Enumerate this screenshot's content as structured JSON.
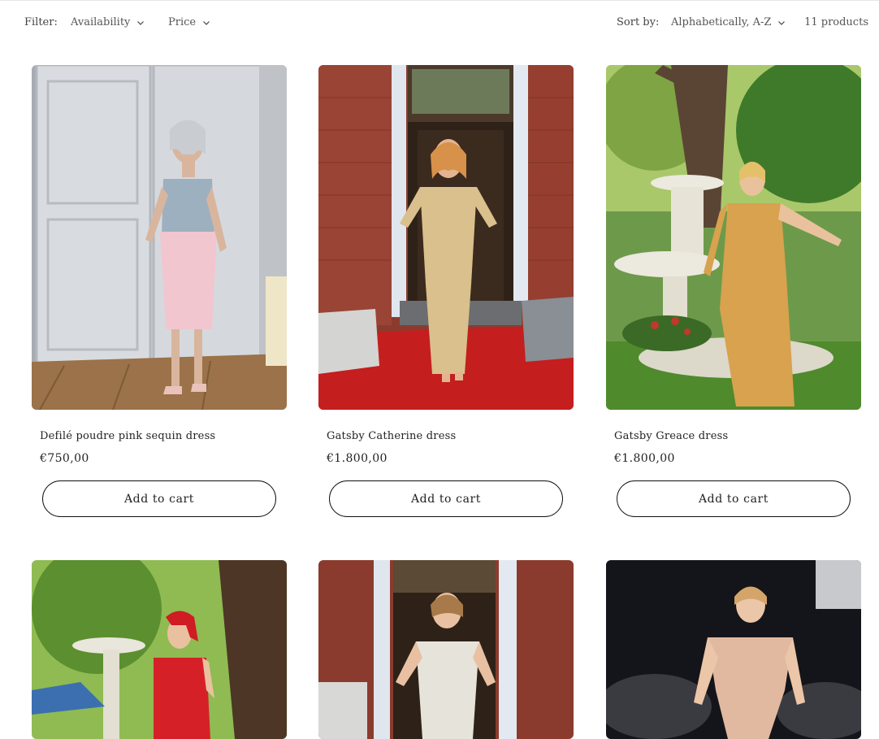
{
  "filter": {
    "label": "Filter:",
    "availability": "Availability",
    "price": "Price"
  },
  "sort": {
    "label": "Sort by:",
    "value": "Alphabetically, A-Z"
  },
  "product_count": "11 products",
  "products": [
    {
      "title": "Defilé poudre pink sequin dress",
      "price": "€750,00",
      "button": "Add to cart"
    },
    {
      "title": "Gatsby Catherine dress",
      "price": "€1.800,00",
      "button": "Add to cart"
    },
    {
      "title": "Gatsby Greace dress",
      "price": "€1.800,00",
      "button": "Add to cart"
    },
    {
      "title": "",
      "price": "",
      "button": ""
    },
    {
      "title": "",
      "price": "",
      "button": ""
    },
    {
      "title": "",
      "price": "",
      "button": ""
    }
  ],
  "icons": {
    "dropdown": "chevron-down-icon"
  },
  "colors": {
    "text": "#222222",
    "border": "#111111",
    "background": "#ffffff"
  }
}
